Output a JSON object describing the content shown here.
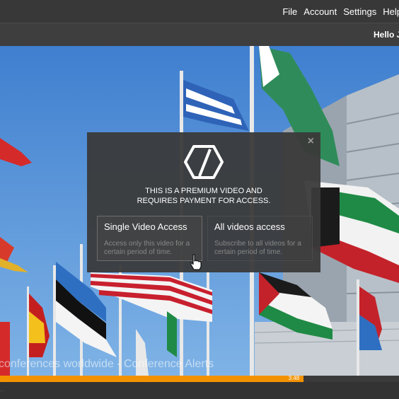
{
  "menu": {
    "items": [
      {
        "label": "File"
      },
      {
        "label": "Account"
      },
      {
        "label": "Settings"
      },
      {
        "label": "Help"
      }
    ]
  },
  "header": {
    "greeting": "Hello J"
  },
  "video": {
    "caption": "conferences worldwide - Conference Alerts",
    "progress": {
      "fraction": 0.76,
      "time": "3:48",
      "color": "#f39200"
    }
  },
  "modal": {
    "close_label": "×",
    "logo_icon": "hexagon-slash-icon",
    "message_line1": "THIS IS A PREMIUM VIDEO AND",
    "message_line2": "REQUIRES PAYMENT FOR ACCESS.",
    "options": [
      {
        "title": "Single Video Access",
        "description": "Access only this video for a certain period of time."
      },
      {
        "title": "All videos access",
        "description": "Subscribe to all videos for a certain period of time."
      }
    ]
  },
  "controls": {
    "edge_text": "..."
  }
}
